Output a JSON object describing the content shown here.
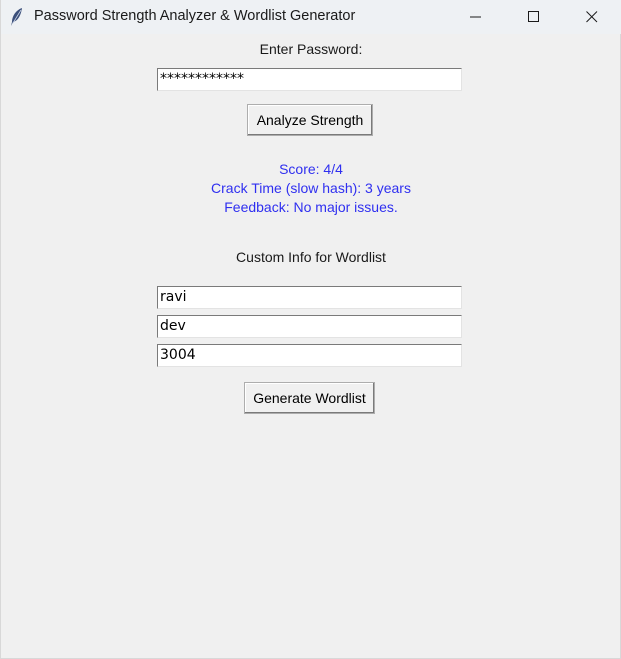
{
  "window": {
    "title": "Password Strength Analyzer & Wordlist Generator",
    "controls": [
      "minimize-icon",
      "maximize-icon",
      "close-icon"
    ]
  },
  "password_section": {
    "label": "Enter Password:",
    "password_value": "************",
    "analyze_button_label": "Analyze Strength"
  },
  "results": {
    "score": "Score: 4/4",
    "crack_time": "Crack Time (slow hash): 3 years",
    "feedback": "Feedback: No major issues.",
    "color": "#2f2ff0"
  },
  "wordlist_section": {
    "label": "Custom Info for Wordlist",
    "fields": [
      "ravi",
      "dev",
      "3004"
    ],
    "generate_button_label": "Generate Wordlist"
  }
}
